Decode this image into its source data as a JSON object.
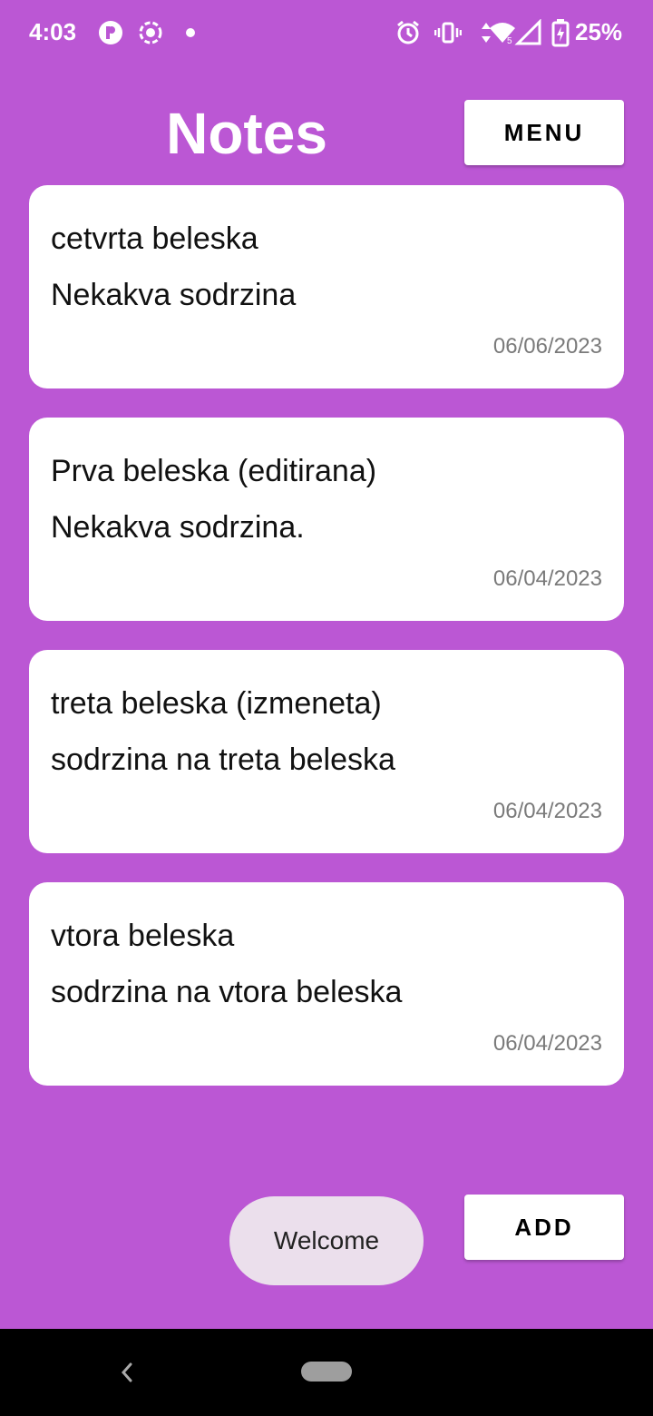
{
  "status_bar": {
    "time": "4:03",
    "battery_percent": "25%",
    "icons": [
      "app-p-icon",
      "screen-record-icon",
      "dot-icon",
      "alarm-icon",
      "vibrate-icon",
      "wifi-icon",
      "signal-icon",
      "battery-charging-icon"
    ]
  },
  "header": {
    "title": "Notes",
    "menu_label": "MENU"
  },
  "notes": [
    {
      "title": "cetvrta beleska",
      "content": "Nekakva sodrzina",
      "date": "06/06/2023"
    },
    {
      "title": "Prva beleska (editirana)",
      "content": "Nekakva sodrzina.",
      "date": "06/04/2023"
    },
    {
      "title": "treta beleska (izmeneta)",
      "content": "sodrzina na treta beleska",
      "date": "06/04/2023"
    },
    {
      "title": "vtora beleska",
      "content": "sodrzina na vtora beleska",
      "date": "06/04/2023"
    }
  ],
  "toast": {
    "message": "Welcome"
  },
  "actions": {
    "add_label": "ADD"
  },
  "colors": {
    "background": "#bb57d4",
    "card": "#ffffff",
    "toast": "#ebdfec"
  }
}
